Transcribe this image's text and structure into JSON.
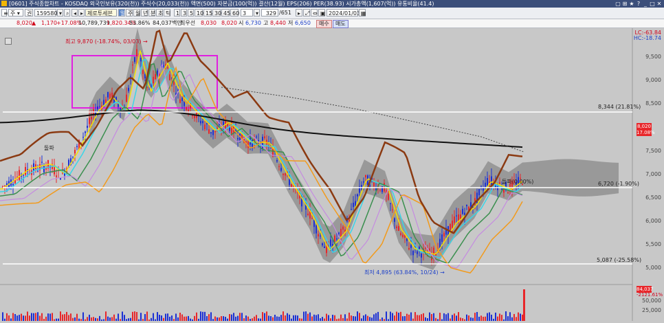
{
  "window": {
    "title": "[0601] 주식종합차트 - KOSDAQ 외국인보유(320(천)) 주식수(20,033(천)) 액면(500) 자본금(100(억)) 결산(12월) EPS(206) PER(38.93) 시가총액(1,607(억)) 유통비율(41.4)",
    "controls": [
      "▢",
      "⊞",
      "★",
      "?",
      "_",
      "□",
      "✕"
    ]
  },
  "toolbar": {
    "period_select": "주",
    "mode_select": "권",
    "code_input": "159580",
    "company_badge": "제로투세븐",
    "period_buttons": [
      "일",
      "주",
      "월",
      "년",
      "분",
      "초",
      "틱"
    ],
    "minute_buttons": [
      "1",
      "3",
      "5",
      "10",
      "15",
      "30",
      "45",
      "60"
    ],
    "count_select": "3",
    "page_counter": "329",
    "page_total": "/651",
    "date_input": "2024/01/03"
  },
  "infobar": {
    "price": "8,020",
    "change_arrow": "▲",
    "change": "1,170",
    "change_pct": "+17.08%",
    "volume": "10,789,739",
    "volume_pct": "1,820.34%",
    "ratio": "53.86%",
    "amount": "84,037백만",
    "best_label": "최우선",
    "ask": "8,030",
    "bid": "8,020",
    "open_label": "시",
    "open": "6,730",
    "high_label": "고",
    "high": "8,440",
    "low_label": "저",
    "low": "6,650",
    "buy_button": "매수",
    "sell_button": "매도"
  },
  "chart": {
    "lc": "LC:-63.84",
    "hc": "HC:-18.74",
    "y_ticks": [
      "9,500",
      "9,000",
      "8,500",
      "8,000",
      "7,500",
      "7,000",
      "6,500",
      "6,000",
      "5,500",
      "5,000"
    ],
    "volume_ticks": [
      "50,000",
      "25,000"
    ],
    "current_price_tag": "8,020",
    "current_pct_tag": "17.08%",
    "volume_tag": "84,037",
    "volume_pct_tag": "-2121.61%",
    "high_note": "최고 9,870 (-18.74%, 03/03) →",
    "low_note": "최저 4,895 (63.84%, 10/24) →",
    "level_8344": "8,344 (21.81%)",
    "level_6720": "6,720 (-1.90%)",
    "level_5087": "5,087 (-25.58%)",
    "breakout_note": "돌파(0.00%)",
    "left_note": "돌파",
    "colors": {
      "up": "#e8262a",
      "down": "#1b2fd4",
      "ma_short": "#f5e400",
      "ma_cyan": "#38d6e8",
      "ma_green": "#3a8f4e",
      "ma_violet": "#c58be0",
      "ma_orange": "#f29a1b",
      "ma_black": "#111111",
      "ma_brown": "#8b3a12",
      "cloud": "#8a8a8a",
      "box": "#e020e0"
    }
  }
}
